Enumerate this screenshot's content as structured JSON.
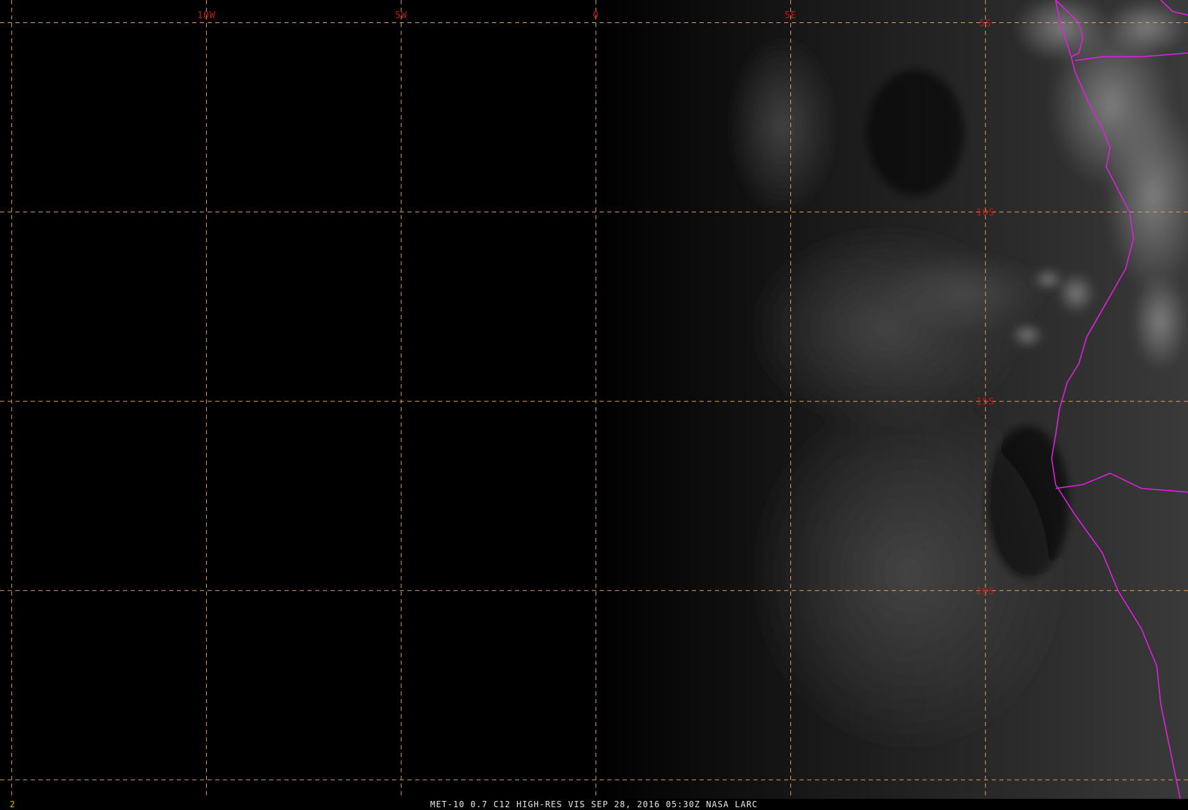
{
  "product": {
    "caption": "MET-10 0.7 C12 HIGH-RES VIS    SEP 28, 2016 05:30Z    NASA LARC",
    "frame_number": "2"
  },
  "grid": {
    "line_color": "#e0a060",
    "label_color": "#c41a1a",
    "longitude_lines": [
      {
        "lon": -15,
        "label": ""
      },
      {
        "lon": -10,
        "label": "10W"
      },
      {
        "lon": -5,
        "label": "5W"
      },
      {
        "lon": 0,
        "label": "0"
      },
      {
        "lon": 5,
        "label": "5E"
      },
      {
        "lon": 10,
        "label": ""
      }
    ],
    "latitude_lines": [
      {
        "lat": -5,
        "label": "5S"
      },
      {
        "lat": -10,
        "label": "10S"
      },
      {
        "lat": -15,
        "label": "15S"
      },
      {
        "lat": -20,
        "label": "20S"
      },
      {
        "lat": -25,
        "label": ""
      }
    ],
    "label_longitude": 10
  },
  "extent": {
    "lon_min": -15.3,
    "lon_max": 15.2,
    "lat_max": -4.4,
    "lat_min": -25.5
  },
  "borders": {
    "color": "#e020e0",
    "coastline": [
      [
        11.8,
        -4.4
      ],
      [
        11.9,
        -4.9
      ],
      [
        12.2,
        -5.9
      ],
      [
        12.3,
        -6.3
      ],
      [
        12.6,
        -7.0
      ],
      [
        13.0,
        -7.8
      ],
      [
        13.2,
        -8.3
      ],
      [
        13.1,
        -8.8
      ],
      [
        13.3,
        -9.2
      ],
      [
        13.7,
        -10.0
      ],
      [
        13.8,
        -10.7
      ],
      [
        13.6,
        -11.5
      ],
      [
        13.1,
        -12.4
      ],
      [
        12.6,
        -13.3
      ],
      [
        12.4,
        -14.0
      ],
      [
        12.1,
        -14.5
      ],
      [
        11.9,
        -15.2
      ],
      [
        11.8,
        -15.9
      ],
      [
        11.7,
        -16.5
      ],
      [
        11.8,
        -17.2
      ],
      [
        12.3,
        -18.0
      ],
      [
        13.0,
        -19.0
      ],
      [
        13.4,
        -20.0
      ],
      [
        14.0,
        -21.0
      ],
      [
        14.4,
        -22.0
      ],
      [
        14.5,
        -23.0
      ],
      [
        14.7,
        -24.0
      ],
      [
        14.9,
        -25.0
      ],
      [
        15.0,
        -25.5
      ]
    ],
    "cabinda_north": [
      [
        11.8,
        -4.4
      ],
      [
        12.1,
        -4.7
      ],
      [
        12.4,
        -5.0
      ],
      [
        12.5,
        -5.4
      ],
      [
        12.4,
        -5.8
      ],
      [
        12.2,
        -5.9
      ]
    ],
    "drc_angola": [
      [
        12.3,
        -6.0
      ],
      [
        13.0,
        -5.9
      ],
      [
        14.0,
        -5.9
      ],
      [
        15.2,
        -5.8
      ]
    ],
    "angola_namibia": [
      [
        11.8,
        -17.3
      ],
      [
        12.5,
        -17.2
      ],
      [
        13.2,
        -16.9
      ],
      [
        14.0,
        -17.3
      ],
      [
        15.2,
        -17.4
      ]
    ],
    "northeast_corner": [
      [
        14.5,
        -4.4
      ],
      [
        14.8,
        -4.7
      ],
      [
        15.2,
        -4.8
      ]
    ]
  }
}
